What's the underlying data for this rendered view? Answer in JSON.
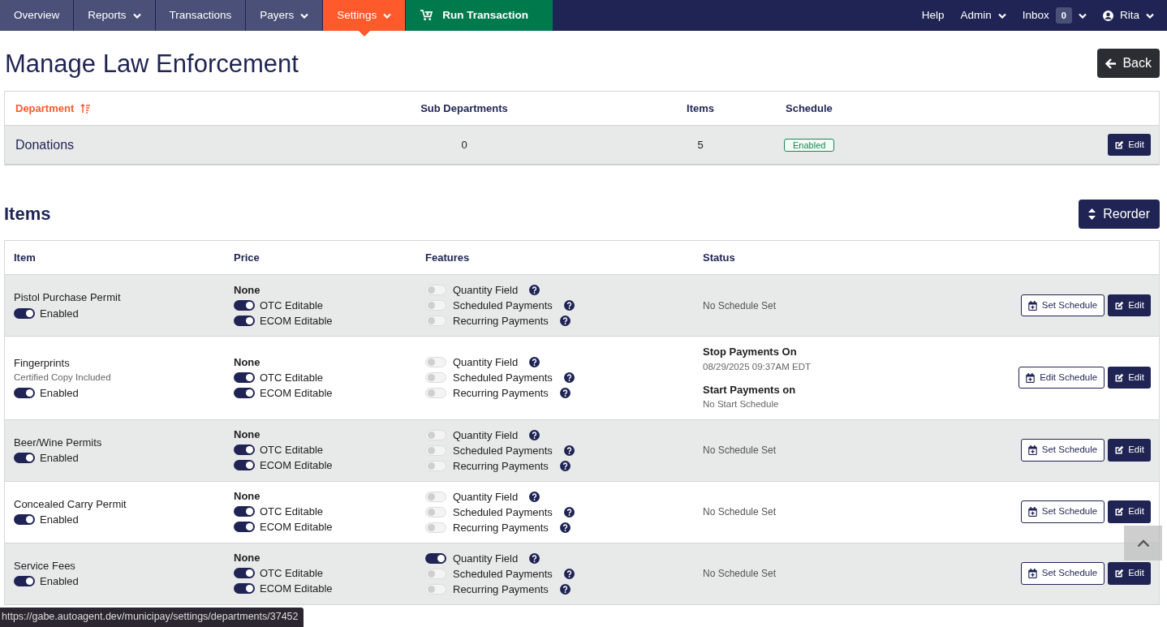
{
  "nav": {
    "left": [
      {
        "label": "Overview",
        "kind": "plain",
        "dropdown": false,
        "selected": false
      },
      {
        "label": "Reports",
        "kind": "plain",
        "dropdown": true,
        "selected": false
      },
      {
        "label": "Transactions",
        "kind": "plain",
        "dropdown": false,
        "selected": false
      },
      {
        "label": "Payers",
        "kind": "plain",
        "dropdown": true,
        "selected": false
      },
      {
        "label": "Settings",
        "kind": "plain",
        "dropdown": true,
        "selected": true
      },
      {
        "label": "Run Transaction",
        "kind": "action",
        "dropdown": false,
        "selected": false
      }
    ],
    "right": [
      {
        "label": "Help",
        "kind": "plain",
        "dropdown": false
      },
      {
        "label": "Admin",
        "kind": "plain",
        "dropdown": true
      },
      {
        "label": "Inbox",
        "kind": "count",
        "badge": "0",
        "dropdown": true
      },
      {
        "label": "Rita",
        "kind": "user",
        "dropdown": true
      }
    ]
  },
  "page": {
    "title": "Manage Law Enforcement",
    "back_button": "Back"
  },
  "department_table": {
    "columns": [
      {
        "label": "Department",
        "sorted": true
      },
      {
        "label": "Sub Departments",
        "sorted": false
      },
      {
        "label": "Items",
        "sorted": false
      },
      {
        "label": "Schedule",
        "sorted": false
      }
    ],
    "rows": [
      {
        "department": "Donations",
        "sub_departments": "0",
        "items": "5",
        "schedule": "Enabled",
        "edit_button": "Edit"
      }
    ]
  },
  "items_section": {
    "title": "Items",
    "reorder_button": "Reorder"
  },
  "items_table": {
    "columns": [
      "Item",
      "Price",
      "Features",
      "Status"
    ],
    "rows": [
      {
        "name": "Pistol Purchase Permit",
        "enabled": {
          "label": "Enabled",
          "on": true
        },
        "price": "None",
        "price_options": [
          {
            "label": "OTC Editable",
            "on": true
          },
          {
            "label": "ECOM Editable",
            "on": true
          }
        ],
        "features": [
          {
            "label": "Quantity Field",
            "on": false
          },
          {
            "label": "Scheduled Payments",
            "on": false
          },
          {
            "label": "Recurring Payments",
            "on": false
          }
        ],
        "status": {
          "kind": "none",
          "text": "No Schedule Set"
        },
        "schedule_button": "Set Schedule",
        "edit_button": "Edit"
      },
      {
        "name": "Fingerprints",
        "note": "Certified Copy Included",
        "enabled": {
          "label": "Enabled",
          "on": true
        },
        "price": "None",
        "price_options": [
          {
            "label": "OTC Editable",
            "on": true
          },
          {
            "label": "ECOM Editable",
            "on": true
          }
        ],
        "features": [
          {
            "label": "Quantity Field",
            "on": false
          },
          {
            "label": "Scheduled Payments",
            "on": false
          },
          {
            "label": "Recurring Payments",
            "on": false
          }
        ],
        "status": {
          "kind": "schedule",
          "lines": [
            {
              "heading": "Stop Payments On",
              "value": "08/29/2025 09:37AM EDT"
            },
            {
              "heading": "Start Payments on",
              "value": "No Start Schedule"
            }
          ]
        },
        "schedule_button": "Edit Schedule",
        "edit_button": "Edit"
      },
      {
        "name": "Beer/Wine Permits",
        "enabled": {
          "label": "Enabled",
          "on": true
        },
        "price": "None",
        "price_options": [
          {
            "label": "OTC Editable",
            "on": true
          },
          {
            "label": "ECOM Editable",
            "on": true
          }
        ],
        "features": [
          {
            "label": "Quantity Field",
            "on": false
          },
          {
            "label": "Scheduled Payments",
            "on": false
          },
          {
            "label": "Recurring Payments",
            "on": false
          }
        ],
        "status": {
          "kind": "none",
          "text": "No Schedule Set"
        },
        "schedule_button": "Set Schedule",
        "edit_button": "Edit"
      },
      {
        "name": "Concealed Carry Permit",
        "enabled": {
          "label": "Enabled",
          "on": true
        },
        "price": "None",
        "price_options": [
          {
            "label": "OTC Editable",
            "on": true
          },
          {
            "label": "ECOM Editable",
            "on": true
          }
        ],
        "features": [
          {
            "label": "Quantity Field",
            "on": false
          },
          {
            "label": "Scheduled Payments",
            "on": false
          },
          {
            "label": "Recurring Payments",
            "on": false
          }
        ],
        "status": {
          "kind": "none",
          "text": "No Schedule Set"
        },
        "schedule_button": "Set Schedule",
        "edit_button": "Edit"
      },
      {
        "name": "Service Fees",
        "enabled": {
          "label": "Enabled",
          "on": true
        },
        "price": "None",
        "price_options": [
          {
            "label": "OTC Editable",
            "on": true
          },
          {
            "label": "ECOM Editable",
            "on": true
          }
        ],
        "features": [
          {
            "label": "Quantity Field",
            "on": true
          },
          {
            "label": "Scheduled Payments",
            "on": false
          },
          {
            "label": "Recurring Payments",
            "on": false
          }
        ],
        "status": {
          "kind": "none",
          "text": "No Schedule Set"
        },
        "schedule_button": "Set Schedule",
        "edit_button": "Edit"
      }
    ]
  },
  "status_url": "https://gabe.autoagent.dev/municipay/settings/departments/37452"
}
